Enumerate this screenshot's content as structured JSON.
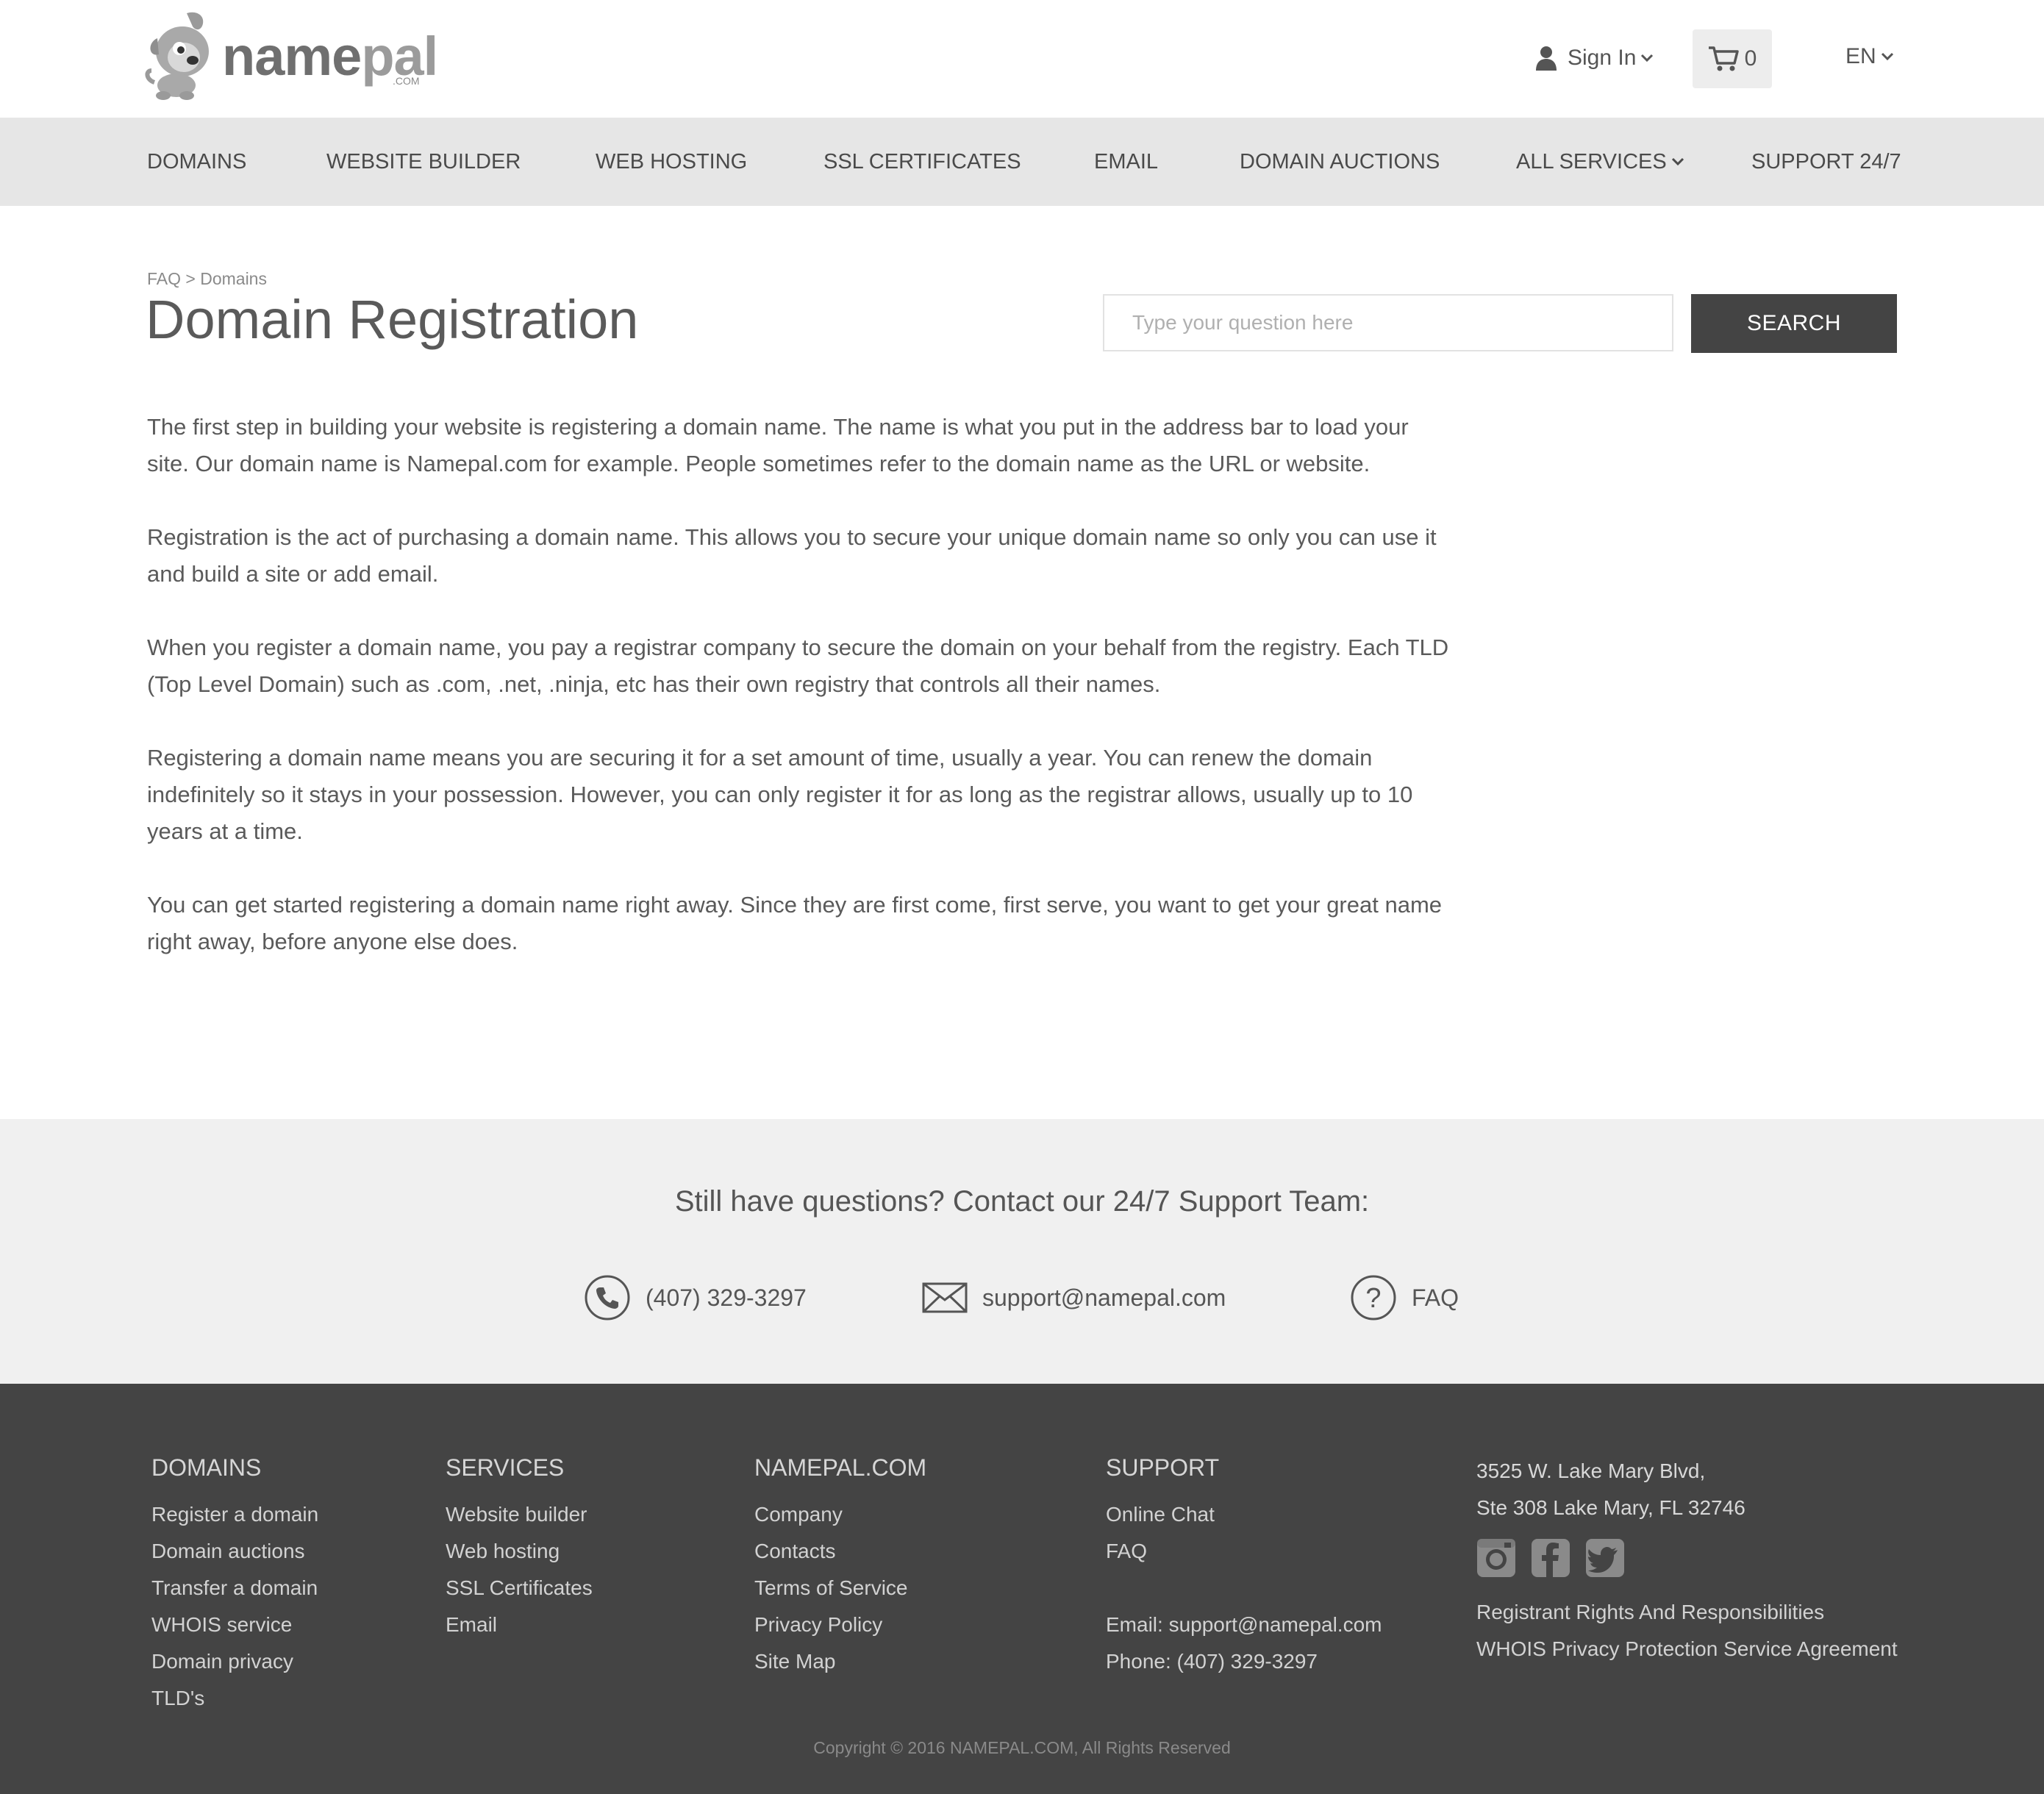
{
  "header": {
    "logo_text_a": "name",
    "logo_text_b": "pal",
    "logo_com": ".COM",
    "signin_label": "Sign In",
    "cart_count": "0",
    "language": "EN"
  },
  "nav": {
    "items": [
      {
        "label": "DOMAINS"
      },
      {
        "label": "WEBSITE BUILDER"
      },
      {
        "label": "WEB HOSTING"
      },
      {
        "label": "SSL CERTIFICATES"
      },
      {
        "label": "EMAIL"
      },
      {
        "label": "DOMAIN AUCTIONS"
      },
      {
        "label": "ALL SERVICES"
      },
      {
        "label": "SUPPORT 24/7"
      }
    ]
  },
  "main": {
    "breadcrumb": "FAQ > Domains",
    "title": "Domain Registration",
    "search_placeholder": "Type your question here",
    "search_button": "SEARCH",
    "paragraphs": [
      "The first step in building your website is registering a domain name. The name is what you put in the address bar to load your site. Our domain name is Namepal.com for example. People sometimes refer to the domain name as the URL or website.",
      "Registration is the act of purchasing a domain name. This allows you to secure your unique domain name so only you can use it and build a site or add email.",
      "When you register a domain name, you pay a registrar company to secure the domain on your behalf from the registry. Each TLD (Top Level Domain) such as .com, .net, .ninja, etc has their own registry that controls all their names.",
      "Registering a domain name means you are securing it for a set amount of time, usually a year. You can renew the domain indefinitely so it stays in your possession. However, you can only register it for as long as the registrar allows, usually up to 10 years at a time.",
      "You can get started registering a domain name right away. Since they are first come, first serve, you want to get your great name right away, before anyone else does."
    ]
  },
  "contact": {
    "title": "Still have questions? Contact our 24/7 Support Team:",
    "phone": "(407) 329-3297",
    "email": "support@namepal.com",
    "faq": "FAQ"
  },
  "footer": {
    "domains": {
      "heading": "DOMAINS",
      "links": [
        "Register a domain",
        "Domain auctions",
        "Transfer a domain",
        "WHOIS service",
        "Domain privacy",
        "TLD's"
      ]
    },
    "services": {
      "heading": "SERVICES",
      "links": [
        "Website builder",
        "Web hosting",
        "SSL Certificates",
        "Email"
      ]
    },
    "namepal": {
      "heading": "NAMEPAL.COM",
      "links": [
        "Company",
        "Contacts",
        "Terms of Service",
        "Privacy Policy",
        "Site Map"
      ]
    },
    "support": {
      "heading": "SUPPORT",
      "links": [
        "Online Chat",
        "FAQ"
      ],
      "email": "Email: support@namepal.com",
      "phone": "Phone: (407) 329-3297"
    },
    "address": {
      "line1": "3525 W. Lake Mary Blvd,",
      "line2": "Ste 308 Lake Mary, FL 32746",
      "social": [
        "instagram-icon",
        "facebook-icon",
        "twitter-icon"
      ],
      "links": [
        "Registrant Rights And Responsibilities",
        "WHOIS Privacy Protection Service Agreement"
      ]
    },
    "copyright": "Copyright © 2016 NAMEPAL.COM, All Rights Reserved"
  }
}
